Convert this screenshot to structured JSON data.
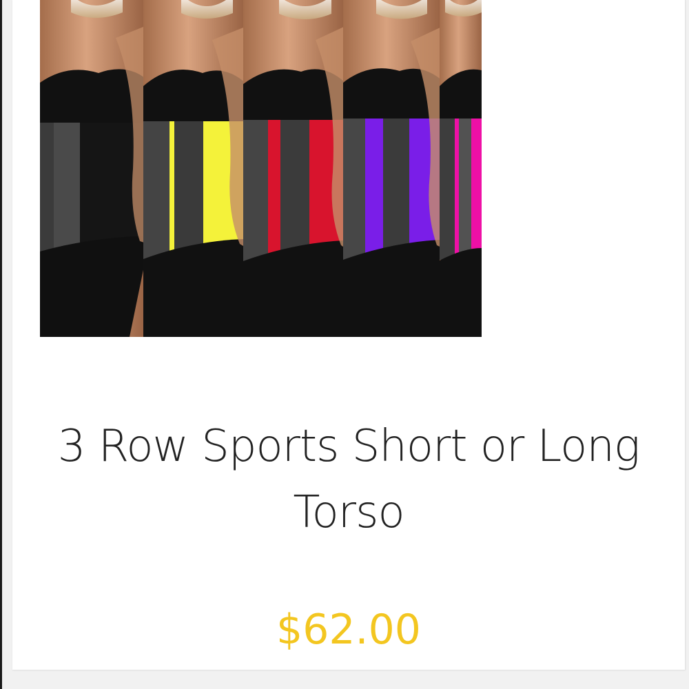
{
  "product": {
    "title": "3 Row Sports Short or Long Torso",
    "price": "$62.00",
    "image_icon": "product-photo",
    "band_colors": [
      "#111111",
      "#f4f23a",
      "#d8142d",
      "#7a1ee8",
      "#ee10a6"
    ]
  },
  "colors": {
    "price": "#f3c620",
    "title": "#222222",
    "card_background": "#ffffff",
    "page_background": "#f1f1f1"
  }
}
